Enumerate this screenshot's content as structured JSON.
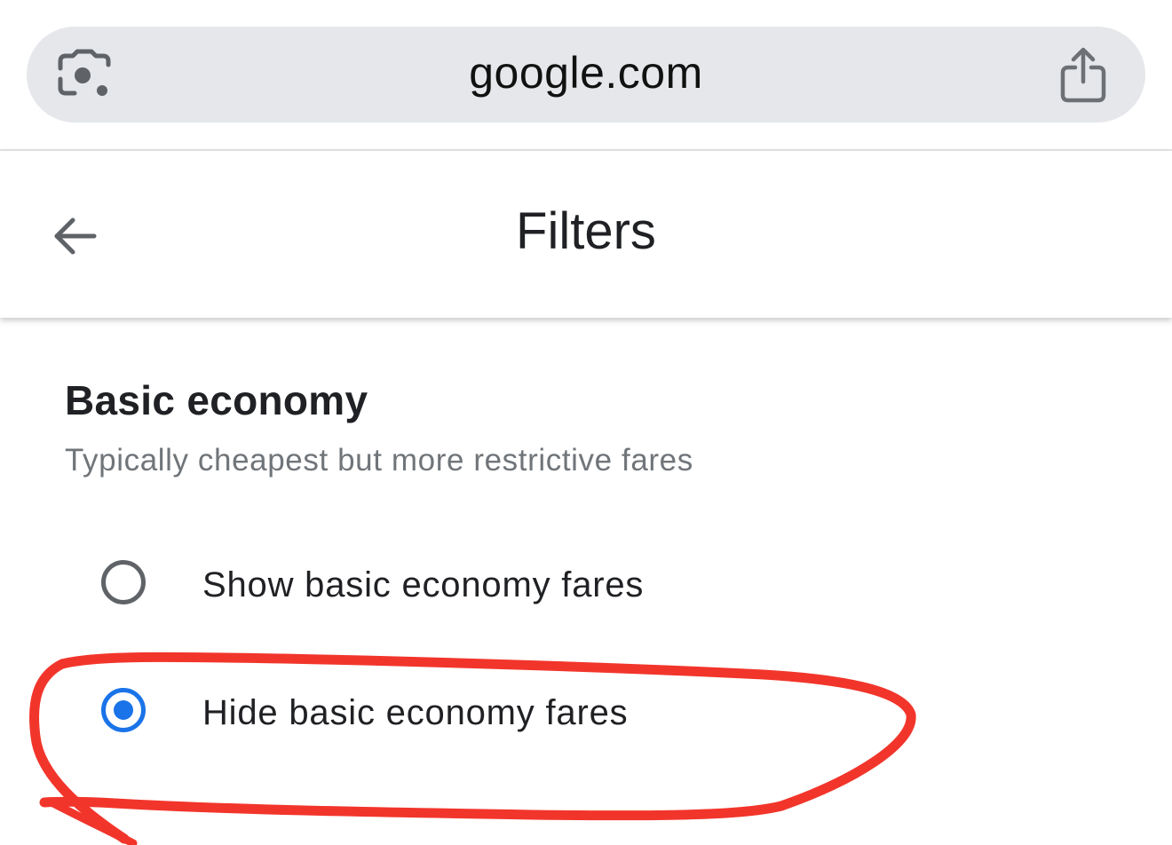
{
  "browser": {
    "url": "google.com",
    "lens_icon": "camera-lens-icon",
    "share_icon": "share-icon"
  },
  "header": {
    "title": "Filters",
    "back_icon": "back-arrow-icon"
  },
  "section": {
    "title": "Basic economy",
    "subtitle": "Typically cheapest but more restrictive fares",
    "options": [
      {
        "label": "Show basic economy fares",
        "selected": false
      },
      {
        "label": "Hide basic economy fares",
        "selected": true
      }
    ]
  },
  "annotation": {
    "shape": "hand-drawn-ellipse",
    "color": "#f2352b",
    "target": "Hide basic economy fares"
  },
  "colors": {
    "accent": "#1a73e8",
    "url_pill": "#e5e7ea",
    "text_primary": "#202124",
    "text_secondary": "#70757a",
    "annotation_red": "#f2352b"
  }
}
